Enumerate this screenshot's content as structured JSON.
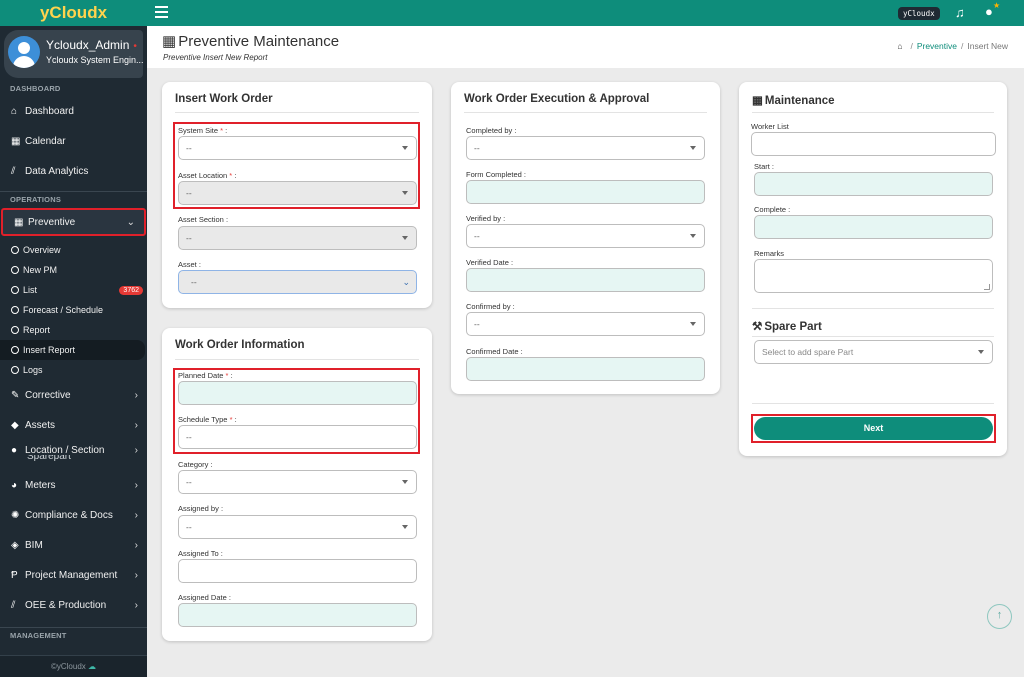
{
  "app": {
    "brand": "yCloudx",
    "footer": "©yCloudx"
  },
  "user": {
    "name": "Ycloudx_Admin",
    "role": "Ycloudx System Engin...",
    "status_dot": "•"
  },
  "topbar": {
    "chip": "yCloudx"
  },
  "sidebar": {
    "sections": {
      "dashboard": "DASHBOARD",
      "operations": "OPERATIONS",
      "management": "MANAGEMENT"
    },
    "dashboard_items": [
      {
        "label": "Dashboard",
        "icon": "home-icon"
      },
      {
        "label": "Calendar",
        "icon": "calendar-icon"
      },
      {
        "label": "Data Analytics",
        "icon": "chart-icon"
      }
    ],
    "preventive": {
      "label": "Preventive",
      "chevron": "⌄"
    },
    "sub_items": [
      {
        "label": "Overview"
      },
      {
        "label": "New PM"
      },
      {
        "label": "List",
        "badge": "3762"
      },
      {
        "label": "Forecast / Schedule"
      },
      {
        "label": "Report"
      },
      {
        "label": "Insert Report"
      },
      {
        "label": "Logs"
      }
    ],
    "ops_items": [
      {
        "label": "Corrective"
      },
      {
        "label": "Assets"
      },
      {
        "label": "Location / Section"
      },
      {
        "label": "Sparepart"
      },
      {
        "label": "Meters"
      },
      {
        "label": "Compliance & Docs"
      },
      {
        "label": "BIM"
      },
      {
        "label": "Project Management"
      },
      {
        "label": "OEE & Production"
      }
    ],
    "chev": "›"
  },
  "page": {
    "title": "Preventive Maintenance",
    "subtitle": "Preventive Insert New Report",
    "breadcrumb": {
      "link": "Preventive",
      "sep": "/",
      "current": "Insert New"
    }
  },
  "insert_work_order": {
    "title": "Insert Work Order",
    "system_site": {
      "label": "System Site",
      "value": "--"
    },
    "asset_location": {
      "label": "Asset Location",
      "value": "--"
    },
    "asset_section": {
      "label": "Asset Section :",
      "value": "--"
    },
    "asset": {
      "label": "Asset :",
      "value": "--"
    }
  },
  "work_order_info": {
    "title": "Work Order Information",
    "planned_date": {
      "label": "Planned Date",
      "value": ""
    },
    "schedule_type": {
      "label": "Schedule Type",
      "value": "--"
    },
    "category": {
      "label": "Category :",
      "value": "--"
    },
    "assigned_by": {
      "label": "Assigned by :",
      "value": "--"
    },
    "assigned_to": {
      "label": "Assigned To :",
      "value": ""
    },
    "assigned_date": {
      "label": "Assigned Date :",
      "value": ""
    }
  },
  "execution": {
    "title": "Work Order Execution & Approval",
    "completed_by": {
      "label": "Completed by :",
      "value": "--"
    },
    "form_completed": {
      "label": "Form Completed :"
    },
    "verified_by": {
      "label": "Verified by :",
      "value": "--"
    },
    "verified_date": {
      "label": "Verified Date :"
    },
    "confirmed_by": {
      "label": "Confirmed by :",
      "value": "--"
    },
    "confirmed_date": {
      "label": "Confirmed Date :"
    }
  },
  "maintenance": {
    "title": "Maintenance",
    "worker_list": {
      "label": "Worker List"
    },
    "start": {
      "label": "Start :"
    },
    "complete": {
      "label": "Complete :"
    },
    "remarks": {
      "label": "Remarks"
    },
    "spare_part": {
      "title": "Spare Part",
      "placeholder": "Select to add spare Part"
    },
    "next": "Next"
  },
  "labels": {
    "required": "*",
    "colon": ":"
  },
  "colors": {
    "accent": "#0e8d7b",
    "highlight": "#e0202a",
    "sidebar": "#1f2a33"
  }
}
